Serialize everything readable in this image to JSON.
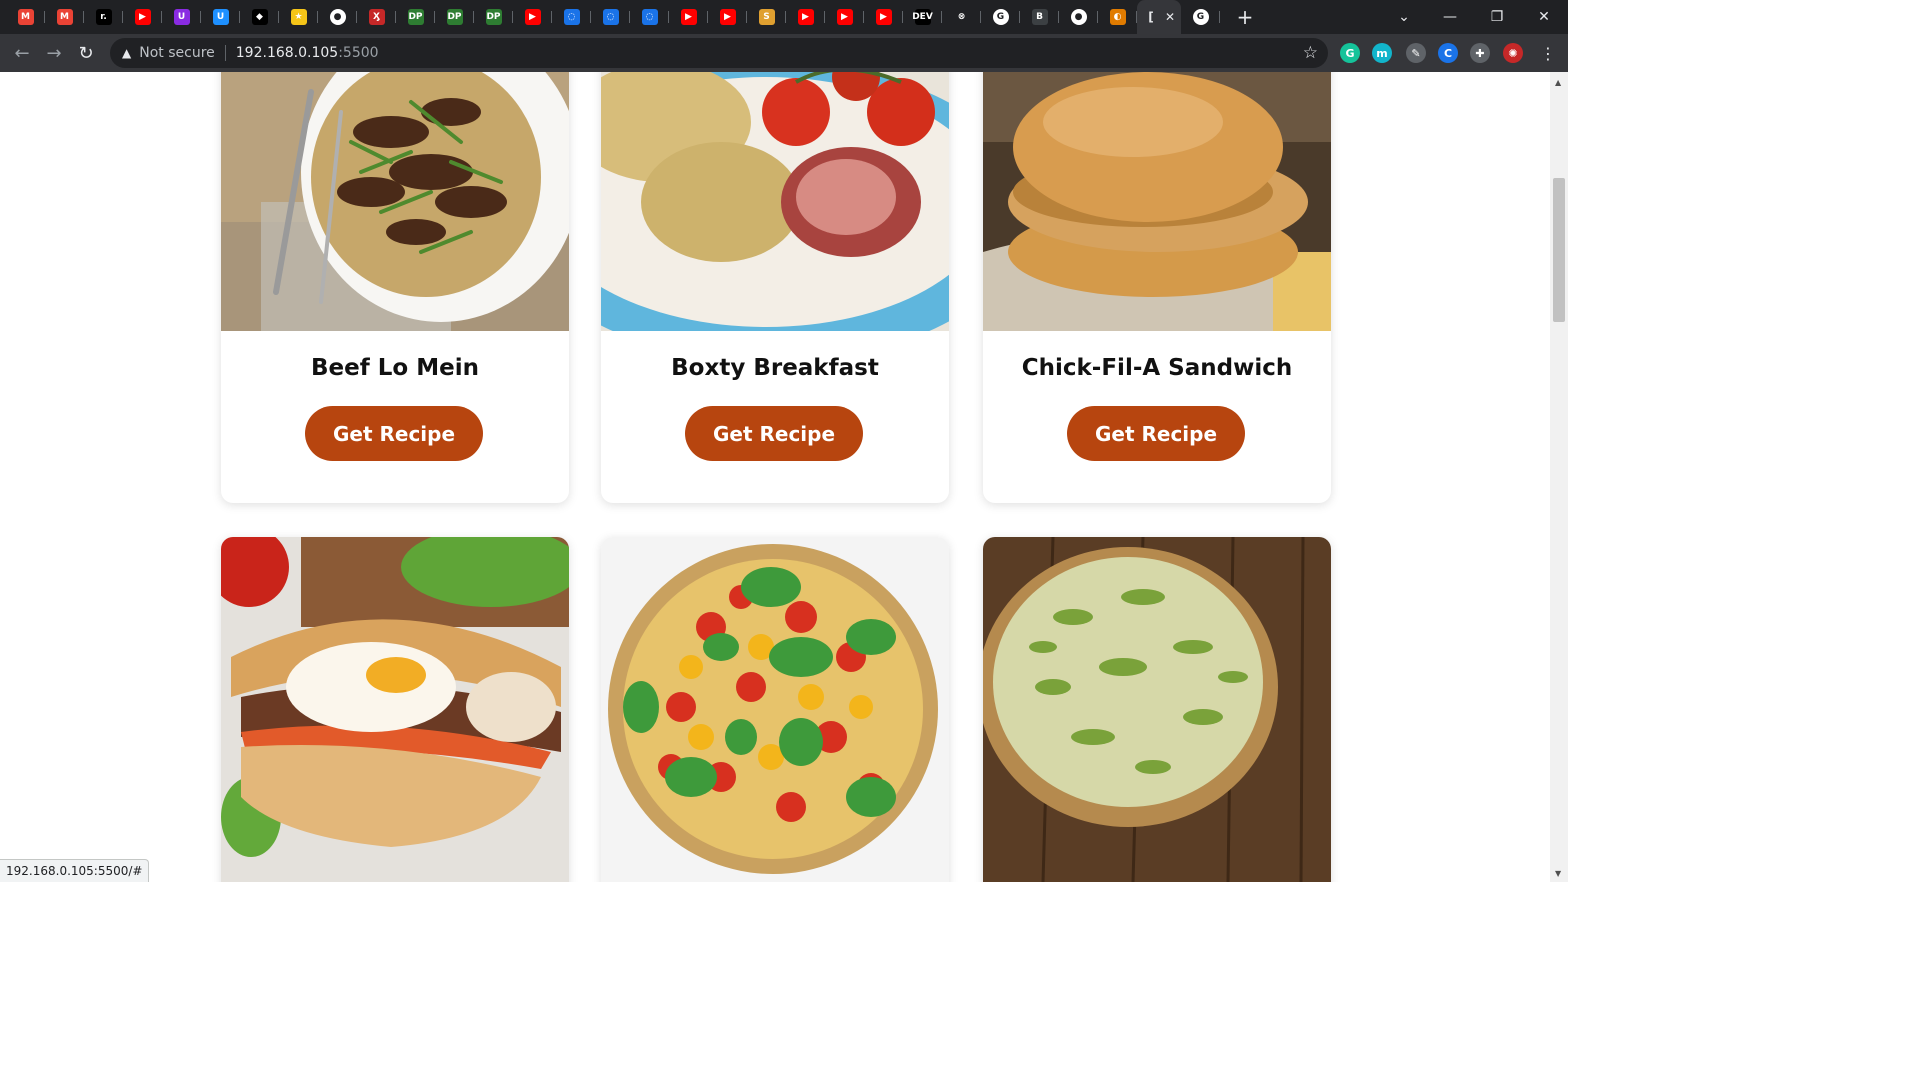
{
  "browser": {
    "tabs": [
      {
        "icon": "gmail-icon",
        "glyph": "M",
        "color": "#ea4335"
      },
      {
        "icon": "gmail-icon",
        "glyph": "M",
        "color": "#ea4335"
      },
      {
        "icon": "app-icon",
        "glyph": "r.",
        "color": "#000000"
      },
      {
        "icon": "youtube-icon",
        "glyph": "▶",
        "color": "#ff0000"
      },
      {
        "icon": "app-icon",
        "glyph": "U",
        "color": "#8a2be2"
      },
      {
        "icon": "app-icon",
        "glyph": "U",
        "color": "#1e90ff"
      },
      {
        "icon": "app-icon",
        "glyph": "◆",
        "color": "#000000"
      },
      {
        "icon": "app-icon",
        "glyph": "★",
        "color": "#f5c518"
      },
      {
        "icon": "github-icon",
        "glyph": "●",
        "color": "#ffffff"
      },
      {
        "icon": "app-icon",
        "glyph": "Ӽ",
        "color": "#c62828"
      },
      {
        "icon": "app-icon",
        "glyph": "DP",
        "color": "#2e7d32"
      },
      {
        "icon": "app-icon",
        "glyph": "DP",
        "color": "#2e7d32"
      },
      {
        "icon": "app-icon",
        "glyph": "DP",
        "color": "#2e7d32"
      },
      {
        "icon": "youtube-icon",
        "glyph": "▶",
        "color": "#ff0000"
      },
      {
        "icon": "loading-icon",
        "glyph": "◌",
        "color": "#1a73e8"
      },
      {
        "icon": "loading-icon",
        "glyph": "◌",
        "color": "#1a73e8"
      },
      {
        "icon": "loading-icon",
        "glyph": "◌",
        "color": "#1a73e8"
      },
      {
        "icon": "youtube-icon",
        "glyph": "▶",
        "color": "#ff0000"
      },
      {
        "icon": "youtube-icon",
        "glyph": "▶",
        "color": "#ff0000"
      },
      {
        "icon": "app-icon",
        "glyph": "S",
        "color": "#e0a030"
      },
      {
        "icon": "youtube-icon",
        "glyph": "▶",
        "color": "#ff0000"
      },
      {
        "icon": "youtube-icon",
        "glyph": "▶",
        "color": "#ff0000"
      },
      {
        "icon": "youtube-icon",
        "glyph": "▶",
        "color": "#ff0000"
      },
      {
        "icon": "dev-icon",
        "glyph": "DEV",
        "color": "#000000"
      },
      {
        "icon": "app-icon",
        "glyph": "⊗",
        "color": "#202124"
      },
      {
        "icon": "google-icon",
        "glyph": "G",
        "color": "#ffffff"
      },
      {
        "icon": "app-icon",
        "glyph": "B",
        "color": "#3c4043"
      },
      {
        "icon": "github-icon",
        "glyph": "●",
        "color": "#ffffff"
      },
      {
        "icon": "app-icon",
        "glyph": "◐",
        "color": "#e07b00"
      },
      {
        "icon": "google-icon",
        "glyph": "G",
        "color": "#ffffff"
      }
    ],
    "active_tab": {
      "glyph": "[",
      "close": "✕"
    },
    "new_tab": "+",
    "address": {
      "security": "Not secure",
      "host": "192.168.0.105",
      "port": ":5500"
    },
    "extensions": [
      {
        "icon": "grammarly-icon",
        "glyph": "G",
        "color": "#15c39a"
      },
      {
        "icon": "extension-m-icon",
        "glyph": "m",
        "color": "#12b5cb"
      },
      {
        "icon": "pen-icon",
        "glyph": "✎",
        "color": "#5f6368"
      },
      {
        "icon": "extension-c-icon",
        "glyph": "C",
        "color": "#1a73e8"
      },
      {
        "icon": "puzzle-icon",
        "glyph": "✚",
        "color": "#5f6368"
      },
      {
        "icon": "profile-avatar-icon",
        "glyph": "✺",
        "color": "#c62828"
      }
    ]
  },
  "recipes": [
    {
      "title": "Beef Lo Mein",
      "button": "Get Recipe"
    },
    {
      "title": "Boxty Breakfast",
      "button": "Get Recipe"
    },
    {
      "title": "Chick-Fil-A Sandwich",
      "button": "Get Recipe"
    },
    {
      "title": "",
      "button": ""
    },
    {
      "title": "",
      "button": ""
    },
    {
      "title": "",
      "button": ""
    }
  ],
  "colors": {
    "button": "#b7450f"
  },
  "status_url": "192.168.0.105:5500/#"
}
